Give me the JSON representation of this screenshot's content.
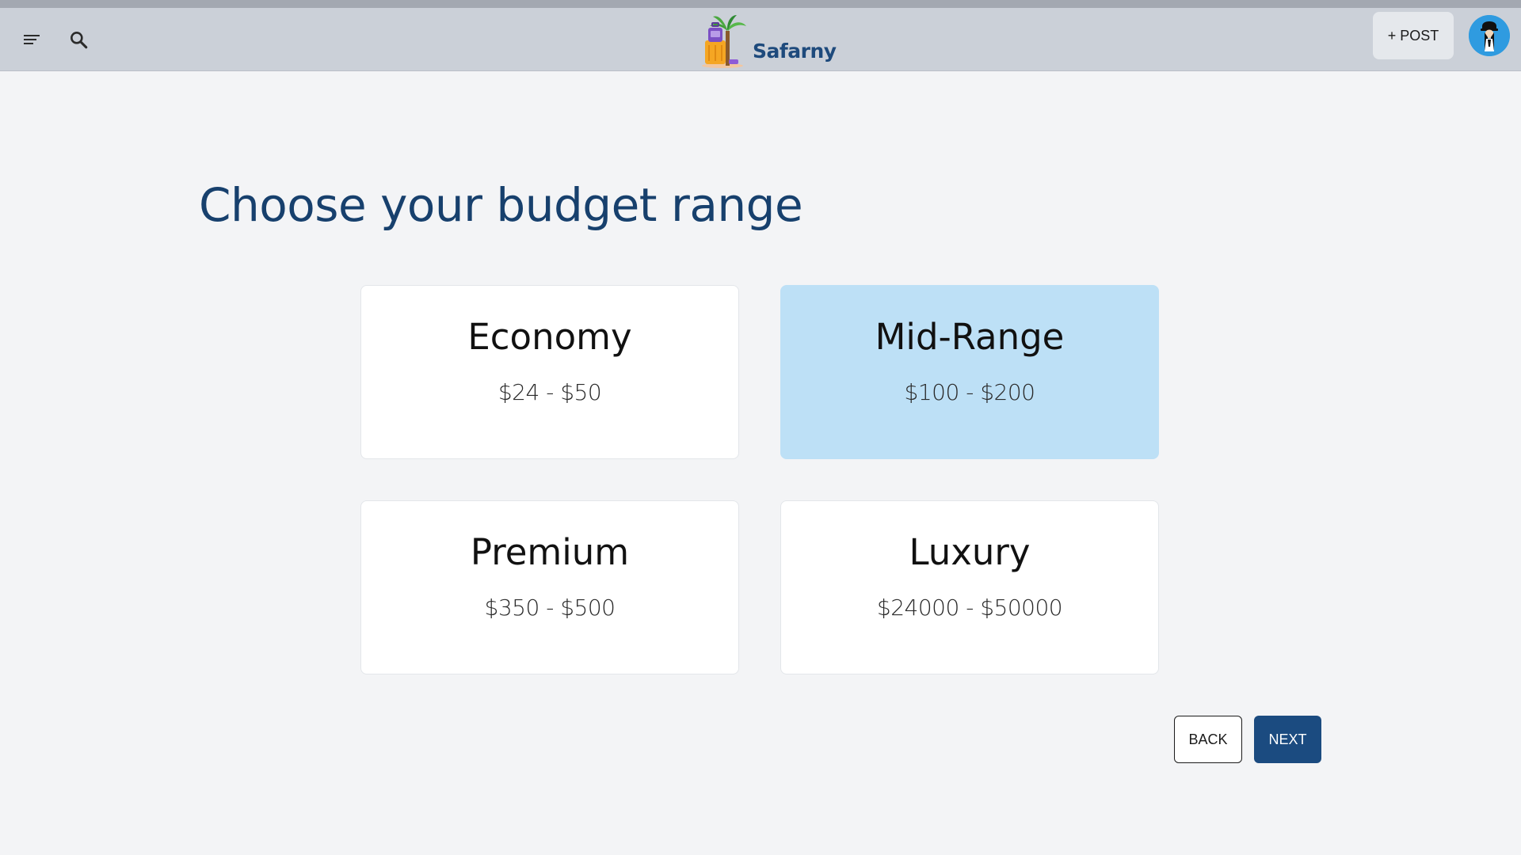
{
  "header": {
    "menu_icon": "menu-icon",
    "search_icon": "search-icon",
    "brand": "Safarny",
    "post_label": "+ POST",
    "avatar_icon": "user-avatar"
  },
  "main": {
    "title": "Choose your budget range",
    "options": [
      {
        "name": "Economy",
        "range": "$24 - $50",
        "selected": false
      },
      {
        "name": "Mid-Range",
        "range": "$100 - $200",
        "selected": true
      },
      {
        "name": "Premium",
        "range": "$350 - $500",
        "selected": false
      },
      {
        "name": "Luxury",
        "range": "$24000 - $50000",
        "selected": false
      }
    ],
    "back_label": "BACK",
    "next_label": "NEXT"
  },
  "colors": {
    "header_bg": "#cbd0d8",
    "page_bg": "#f3f4f6",
    "title": "#17406d",
    "selected_card": "#bde0f6",
    "primary_button": "#1b4b80",
    "avatar_bg": "#2f9be0"
  }
}
